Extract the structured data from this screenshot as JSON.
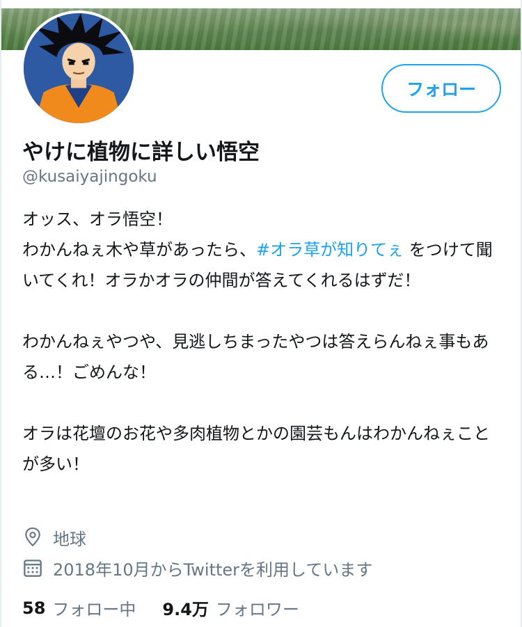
{
  "profile": {
    "display_name": "やけに植物に詳しい悟空",
    "handle": "@kusaiyajingoku",
    "follow_button_label": "フォロー"
  },
  "bio": {
    "line1": "オッス、オラ悟空！",
    "line2_before": "わかんねぇ木や草があったら、",
    "hashtag": "#オラ草が知りてぇ",
    "line2_after": " をつけて聞いてくれ！オラかオラの仲間が答えてくれるはずだ！",
    "para2": "わかんねぇやつや、見逃しちまったやつは答えらんねぇ事もある…！ごめんな！",
    "para3": "オラは花壇のお花や多肉植物とかの園芸もんはわかんねぇことが多い！"
  },
  "meta": {
    "location": "地球",
    "joined": "2018年10月からTwitterを利用しています",
    "location_icon": "location-pin-icon",
    "calendar_icon": "calendar-icon"
  },
  "stats": {
    "following_count": "58",
    "following_label": "フォロー中",
    "followers_count": "9.4万",
    "followers_label": "フォロワー"
  },
  "colors": {
    "accent": "#1da1f2",
    "secondary_text": "#657786",
    "primary_text": "#14171a"
  }
}
